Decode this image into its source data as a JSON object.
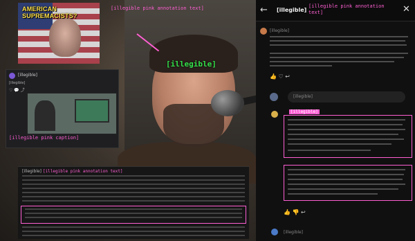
{
  "thumbnail": {
    "title": "AMERICAN SUPREMACISTS?"
  },
  "video": {
    "pink_note": "[illegible pink annotation text]",
    "green_label": "[illegible]"
  },
  "post_card": {
    "user": "[illegible]",
    "body": "[illegible]",
    "actions": "♡  💬  ⤴",
    "caption": "[illegible pink caption]"
  },
  "comment_panel": {
    "head": "[illegible]",
    "pink_head": "[illegible pink annotation text]"
  },
  "right_panel": {
    "back": "←",
    "title": "[illegible]",
    "pink_note": "[illegible pink annotation text]",
    "close": "✕",
    "comment1_user": "[illegible]",
    "actions1": "👍  ♡  ↩",
    "reply_placeholder": "[illegible]",
    "comment2_user": "[illegible]",
    "actions2": "👍  👎  ↩",
    "bottom_user": "[illegible]"
  },
  "colors": {
    "annotation_pink": "#ff5fd3",
    "label_green": "#34e04a",
    "title_yellow": "#ffe14a"
  },
  "icons": [
    "back-arrow-icon",
    "close-icon",
    "like-icon",
    "dislike-icon",
    "reply-icon",
    "heart-icon",
    "comment-icon",
    "share-icon"
  ]
}
